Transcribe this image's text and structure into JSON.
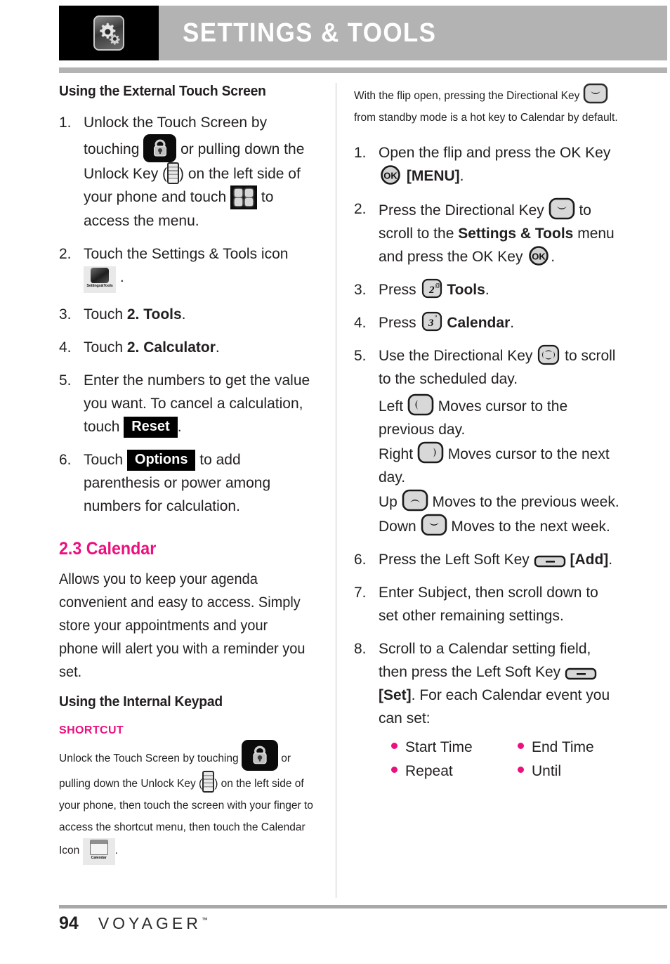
{
  "header": {
    "title": "SETTINGS & TOOLS",
    "icon": "gear-icon"
  },
  "left": {
    "heading_external": "Using the External Touch Screen",
    "steps": [
      {
        "num": "1.",
        "t1": "Unlock the Touch Screen by touching",
        "t2": "or pulling down the Unlock Key (",
        "t3": ") on the left side of your phone and touch",
        "t4": "to access the menu."
      },
      {
        "num": "2.",
        "t1": "Touch the Settings & Tools icon",
        "t2": "."
      },
      {
        "num": "3.",
        "t1": "Touch ",
        "b1": "2. Tools",
        "t2": "."
      },
      {
        "num": "4.",
        "t1": "Touch ",
        "b1": "2. Calculator",
        "t2": "."
      },
      {
        "num": "5.",
        "t1": "Enter the numbers to get the value you want. To cancel a calculation, touch",
        "badge": "Reset",
        "t2": "."
      },
      {
        "num": "6.",
        "t1": "Touch",
        "badge": "Options",
        "t2": "to add parenthesis or power among numbers for calculation."
      }
    ],
    "section_heading": "2.3 Calendar",
    "section_body": "Allows you to keep your agenda convenient and easy to access. Simply store your appointments and your phone will alert you with a reminder you set.",
    "heading_internal": "Using the Internal Keypad",
    "shortcut": {
      "title": "SHORTCUT",
      "t1": "Unlock the Touch Screen by touching",
      "t2": "or pulling down the Unlock Key (",
      "t3": ") on the left side of your phone, then touch the screen with your finger to access the shortcut menu, then touch the Calendar Icon",
      "t4": "."
    }
  },
  "right": {
    "note": {
      "t1": "With the flip open, pressing the Directional Key",
      "t2": "from standby mode is a hot key to Calendar by default."
    },
    "steps": [
      {
        "num": "1.",
        "t1": "Open the flip and press the OK Key",
        "b1": "[MENU]",
        "t2": "."
      },
      {
        "num": "2.",
        "t1": "Press the Directional Key",
        "t2": "to scroll to the",
        "b1": "Settings & Tools",
        "t3": "menu and press the OK Key",
        "t4": "."
      },
      {
        "num": "3.",
        "t1": "Press",
        "b1": "Tools",
        "t2": ".",
        "key": "2",
        "sup": "@"
      },
      {
        "num": "4.",
        "t1": "Press",
        "b1": "Calendar",
        "t2": ".",
        "key": "3",
        "sup": "”"
      },
      {
        "num": "5.",
        "t1": "Use the Directional Key",
        "t2": "to scroll to the scheduled day.",
        "dirs": [
          {
            "label": "Left",
            "desc": "Moves cursor to the previous day."
          },
          {
            "label": "Right",
            "desc": "Moves cursor to the next day."
          },
          {
            "label": "Up",
            "desc": "Moves to the previous week."
          },
          {
            "label": "Down",
            "desc": "Moves to the next week."
          }
        ]
      },
      {
        "num": "6.",
        "t1": "Press the Left Soft Key",
        "b1": "[Add]",
        "t2": "."
      },
      {
        "num": "7.",
        "t1": "Enter Subject, then scroll down to set other remaining settings."
      },
      {
        "num": "8.",
        "t1": "Scroll to a Calendar setting field, then press the Left Soft Key",
        "b1": "[Set]",
        "t2": ". For each Calendar event you can set:"
      }
    ],
    "event_fields": [
      "Start Time",
      "End Time",
      "Repeat",
      "Until"
    ]
  },
  "footer": {
    "page": "94",
    "brand": "VOYAGER",
    "tm": "™"
  },
  "colors": {
    "accent_pink": "#ec0f7e",
    "header_gray": "#b3b3b3",
    "text": "#231f20"
  }
}
